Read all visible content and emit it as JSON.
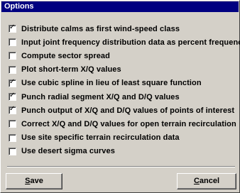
{
  "window": {
    "title": "Options"
  },
  "options": [
    {
      "label": "Distribute calms as first wind-speed class",
      "checked": true
    },
    {
      "label": "Input joint frequency distribution data as percent frequency",
      "checked": false
    },
    {
      "label": "Compute sector spread",
      "checked": false
    },
    {
      "label": "Plot short-term X/Q values",
      "checked": false
    },
    {
      "label": "Use cubic spline in lieu of least square function",
      "checked": true
    },
    {
      "label": "Punch radial segment X/Q and D/Q values",
      "checked": true
    },
    {
      "label": "Punch output of X/Q and D/Q values of points of interest",
      "checked": true
    },
    {
      "label": "Correct X/Q and D/Q values for open terrain recirculation",
      "checked": false
    },
    {
      "label": "Use site specific terrain recirculation data",
      "checked": false
    },
    {
      "label": "Use desert sigma curves",
      "checked": false
    }
  ],
  "buttons": {
    "save_mnemonic": "S",
    "save_rest": "ave",
    "cancel_mnemonic": "C",
    "cancel_rest": "ancel"
  },
  "colors": {
    "titlebar_bg": "#000080",
    "titlebar_text": "#ffffff",
    "dialog_bg": "#d4d0c8"
  },
  "icons": {
    "check": "checkmark-icon"
  }
}
